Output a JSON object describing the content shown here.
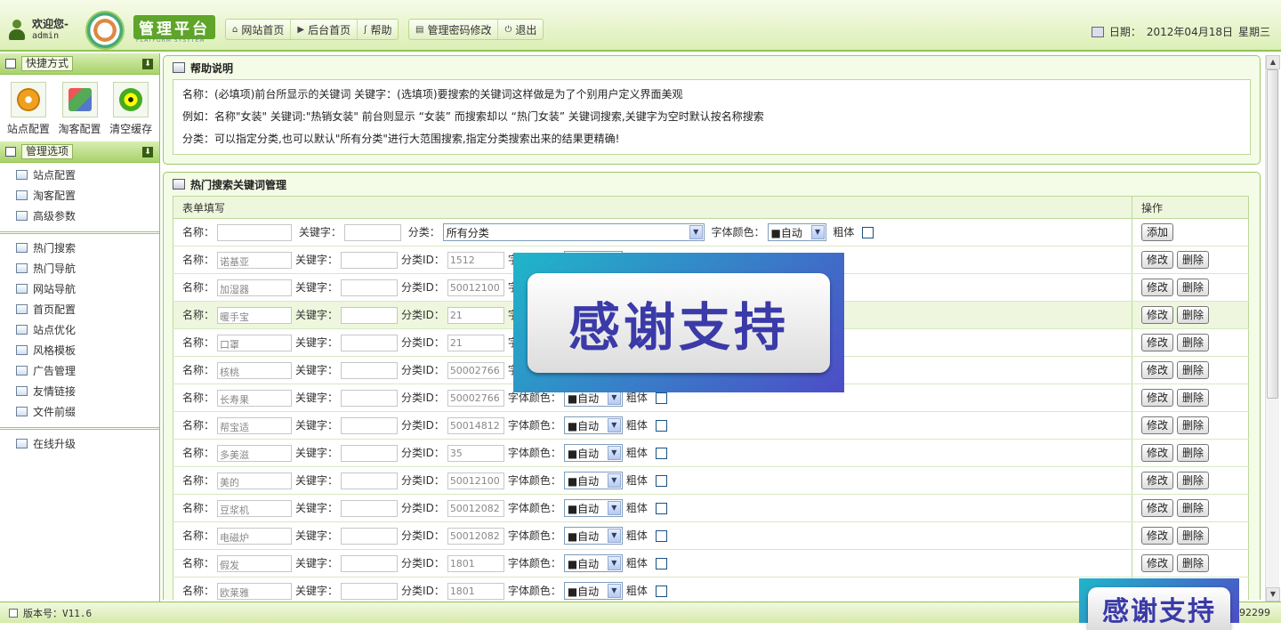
{
  "header": {
    "welcome": "欢迎您-",
    "username": "admin",
    "logo_title": "管理平台",
    "logo_subtitle": "PLATFORM SYSYTEM",
    "nav": [
      {
        "label": "网站首页",
        "icon": "home-icon",
        "glyph": "⌂"
      },
      {
        "label": "后台首页",
        "icon": "play-icon",
        "glyph": "▶"
      },
      {
        "label": "帮助",
        "icon": "help-icon",
        "glyph": "ʃ"
      }
    ],
    "nav2": [
      {
        "label": "管理密码修改",
        "icon": "password-icon",
        "glyph": "▤"
      },
      {
        "label": "退出",
        "icon": "power-icon",
        "glyph": "⏻"
      }
    ],
    "date_label": "日期：",
    "date_value": "2012年04月18日",
    "weekday": "星期三"
  },
  "sidebar": {
    "quick_title": "快捷方式",
    "quick_items": [
      {
        "label": "站点配置",
        "icon": "gears-icon"
      },
      {
        "label": "淘客配置",
        "icon": "config-icon"
      },
      {
        "label": "清空缓存",
        "icon": "radiation-icon"
      }
    ],
    "manage_title": "管理选项",
    "group1": [
      "站点配置",
      "淘客配置",
      "高级参数"
    ],
    "group2": [
      "热门搜索",
      "热门导航",
      "网站导航",
      "首页配置",
      "站点优化",
      "风格模板",
      "广告管理",
      "友情链接",
      "文件前缀"
    ],
    "group3": [
      "在线升级"
    ]
  },
  "help": {
    "title": "帮助说明",
    "lines": [
      "名称：(必填项)前台所显示的关键词  关键字：(选填项)要搜索的关键词这样做是为了个别用户定义界面美观",
      "例如：名称\"女装\" 关键词:\"热销女装\" 前台则显示 “女装” 而搜索却以 “热门女装” 关键词搜索,关键字为空时默认按名称搜索",
      "分类：可以指定分类,也可以默认\"所有分类\"进行大范围搜索,指定分类搜索出来的结果更精确!"
    ]
  },
  "table": {
    "title": "热门搜索关键词管理",
    "header_form": "表单填写",
    "header_op": "操作",
    "labels": {
      "name": "名称：",
      "keyword": "关键字：",
      "category": "分类：",
      "category_id": "分类ID：",
      "font_color": "字体颜色：",
      "bold": "粗体"
    },
    "add_row": {
      "category_select": "所有分类",
      "color_select": "■自动",
      "button": "添加"
    },
    "color_value": "■自动",
    "edit_button": "修改",
    "delete_button": "删除",
    "rows": [
      {
        "name": "诺基亚",
        "cid": "1512"
      },
      {
        "name": "加湿器",
        "cid": "50012100"
      },
      {
        "name": "暖手宝",
        "cid": "21"
      },
      {
        "name": "口罩",
        "cid": "21"
      },
      {
        "name": "核桃",
        "cid": "50002766"
      },
      {
        "name": "长寿果",
        "cid": "50002766"
      },
      {
        "name": "帮宝适",
        "cid": "50014812"
      },
      {
        "name": "多美滋",
        "cid": "35"
      },
      {
        "name": "美的",
        "cid": "50012100"
      },
      {
        "name": "豆浆机",
        "cid": "50012082"
      },
      {
        "name": "电磁炉",
        "cid": "50012082"
      },
      {
        "name": "假发",
        "cid": "1801"
      },
      {
        "name": "欧莱雅",
        "cid": "1801"
      }
    ]
  },
  "footer": {
    "version": "版本号：V11.6",
    "right": "92299"
  },
  "overlay": {
    "text": "感谢支持"
  }
}
